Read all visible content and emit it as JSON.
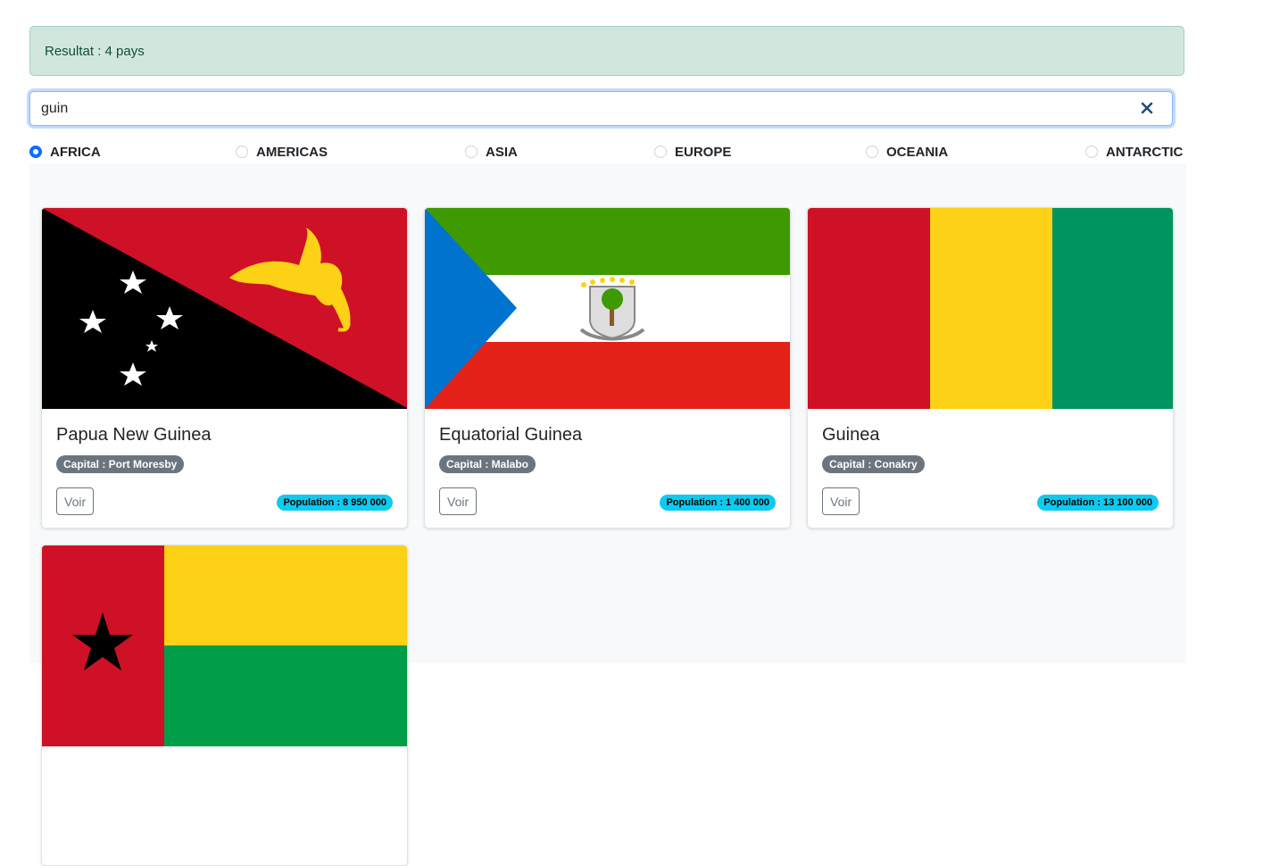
{
  "result_alert": {
    "text": "Resultat : 4 pays"
  },
  "search": {
    "value": "guin",
    "clear_icon": "close-x-icon"
  },
  "regions": [
    {
      "label": "AFRICA",
      "selected": true
    },
    {
      "label": "AMERICAS",
      "selected": false
    },
    {
      "label": "ASIA",
      "selected": false
    },
    {
      "label": "EUROPE",
      "selected": false
    },
    {
      "label": "OCEANIA",
      "selected": false
    },
    {
      "label": "ANTARCTIC",
      "selected": false
    }
  ],
  "countries": [
    {
      "name": "Papua New Guinea",
      "capital": "Capital : Port Moresby",
      "population": "Population : 8 950 000",
      "button": "Voir",
      "flag": "papua-new-guinea-flag"
    },
    {
      "name": "Equatorial Guinea",
      "capital": "Capital : Malabo",
      "population": "Population : 1 400 000",
      "button": "Voir",
      "flag": "equatorial-guinea-flag"
    },
    {
      "name": "Guinea",
      "capital": "Capital : Conakry",
      "population": "Population : 13 100 000",
      "button": "Voir",
      "flag": "guinea-flag"
    },
    {
      "name": "",
      "capital": "",
      "population": "",
      "button": "",
      "flag": "guinea-bissau-flag"
    }
  ],
  "colors": {
    "alert_bg": "#d1e7dd",
    "primary": "#0d6efd",
    "secondary_badge": "#6c757d",
    "info_badge": "#0dcaf0"
  }
}
